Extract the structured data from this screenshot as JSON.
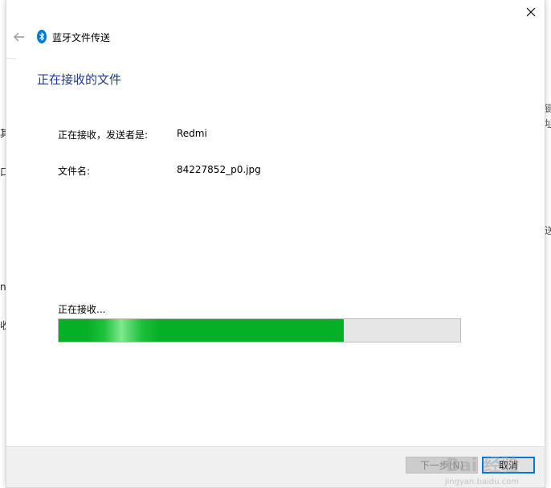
{
  "background": {
    "left_fragments": [
      "其",
      "口",
      "n",
      "收"
    ],
    "right_fragments": [
      "键",
      "址",
      "送"
    ]
  },
  "dialog": {
    "title": "蓝牙文件传送",
    "heading": "正在接收的文件",
    "sender_label": "正在接收，发送者是:",
    "sender_value": "Redmi",
    "file_label": "文件名:",
    "file_value": "84227852_p0.jpg",
    "status": "正在接收...",
    "progress_fraction": 0.71
  },
  "buttons": {
    "next_label": "下一步(N)",
    "cancel_label": "取消"
  },
  "watermark": {
    "text": "Bai 经验",
    "subtext": "jingyan.baidu.com"
  },
  "colors": {
    "accent": "#0078d7",
    "heading": "#1e3a8a",
    "progress_fill": "#06b025",
    "bluetooth": "#0078d7"
  },
  "icons": {
    "back": "arrow-left-icon",
    "bluetooth": "bluetooth-icon",
    "close": "close-icon"
  }
}
